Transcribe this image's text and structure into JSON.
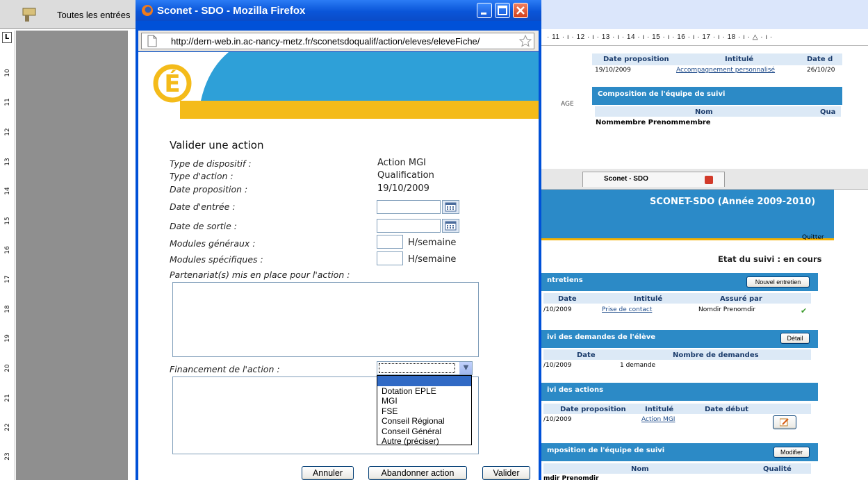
{
  "word": {
    "toolbar_entries": "Toutes les entrées",
    "ruler_text": "· 11 · ı · 12 · ı · 13 · ı · 14 · ı · 15 · ı · 16 · ı · 17 · ı · 18 · ı · △ · ı ·",
    "ruler_corner": "L",
    "vruler_numbers": [
      "10",
      "11",
      "12",
      "13",
      "14",
      "15",
      "16",
      "17",
      "18",
      "19",
      "20",
      "21",
      "22",
      "23"
    ]
  },
  "background_page": {
    "table1_headers": [
      "Date proposition",
      "Intitulé",
      "Date d"
    ],
    "table1_row": [
      "19/10/2009",
      "Accompagnement personnalisé",
      "26/10/20"
    ],
    "panel_team_title": "Composition de l'équipe de suivi",
    "team_headers": [
      "Nom",
      "Qua"
    ],
    "team_row": "Nommembre Prenommembre",
    "side_label": "AGE",
    "tab_label": "Sconet - SDO",
    "app_title": "SCONET-SDO (Année 2009-2010)",
    "quitter": "Quitter",
    "etat": "Etat du suivi : en cours",
    "entretiens_title": "ntretiens",
    "nouvel_entretien": "Nouvel entretien",
    "entretiens_headers": [
      "Date",
      "Intitulé",
      "Assuré par"
    ],
    "entretiens_row": [
      "/10/2009",
      "Prise de contact",
      "Nomdir Prenomdir"
    ],
    "demandes_title": "ivi des demandes de l'élève",
    "detail": "Détail",
    "demandes_headers": [
      "Date",
      "Nombre de demandes"
    ],
    "demandes_row": [
      "/10/2009",
      "1 demande"
    ],
    "actions_title": "ivi des actions",
    "actions_headers": [
      "Date proposition",
      "Intitulé",
      "Date début"
    ],
    "actions_row": [
      "/10/2009",
      "Action MGI"
    ],
    "team2_title": "mposition de l'équipe de suivi",
    "modifier": "Modifier",
    "team2_headers": [
      "Nom",
      "Qualité"
    ],
    "team2_row": "mdir Prenomdir"
  },
  "window": {
    "title": "Sconet - SDO - Mozilla Firefox",
    "url": "http://dern-web.in.ac-nancy-metz.fr/sconetsdoqualif/action/eleves/eleveFiche/"
  },
  "form": {
    "title": "Valider une action",
    "type_dispositif_label": "Type de dispositif :",
    "type_dispositif_value": "Action MGI",
    "type_action_label": "Type d'action :",
    "type_action_value": "Qualification",
    "date_proposition_label": "Date proposition :",
    "date_proposition_value": "19/10/2009",
    "date_entree_label": "Date d'entrée :",
    "date_sortie_label": "Date de sortie :",
    "modules_generaux_label": "Modules généraux :",
    "modules_specifiques_label": "Modules spécifiques :",
    "unit": "H/semaine",
    "partenariat_label": "Partenariat(s) mis en place pour l'action :",
    "financement_label": "Financement de l'action :",
    "financement_options": [
      "",
      "Dotation EPLE",
      "MGI",
      "FSE",
      "Conseil Régional",
      "Conseil Général",
      "Autre (préciser)"
    ]
  },
  "buttons": {
    "annuler": "Annuler",
    "abandonner": "Abandonner action",
    "valider": "Valider"
  },
  "colors": {
    "xp_blue": "#0051d8",
    "banner_blue": "#2ea0d8",
    "banner_gold": "#f4bb1a",
    "panel_blue": "#2c8ac6"
  }
}
